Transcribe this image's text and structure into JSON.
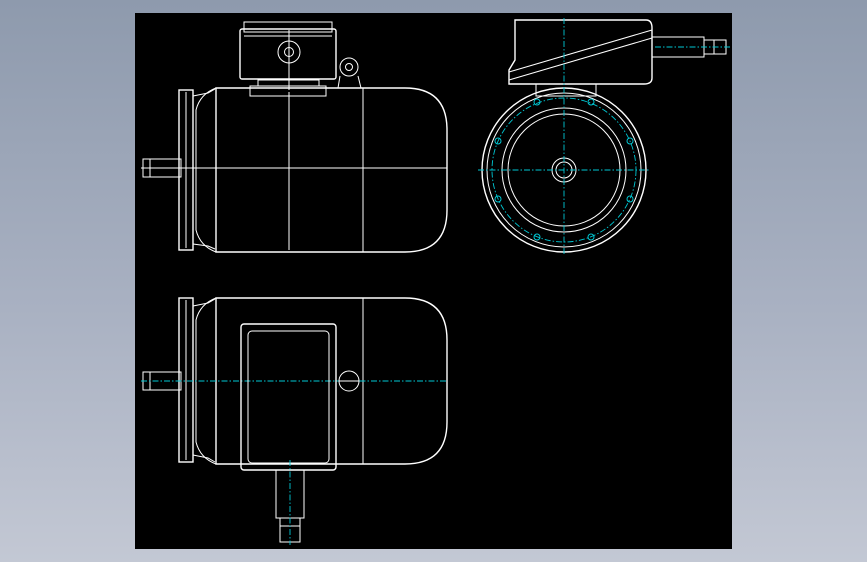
{
  "canvas": {
    "background_color": "#000000",
    "frame_color": "#8e9aad",
    "line_color": "#ffffff",
    "centerline_color": "#00c8d4"
  },
  "views": [
    {
      "name": "front-view",
      "description_hidden": true
    },
    {
      "name": "end-view",
      "description_hidden": true
    },
    {
      "name": "top-view",
      "description_hidden": true
    }
  ]
}
